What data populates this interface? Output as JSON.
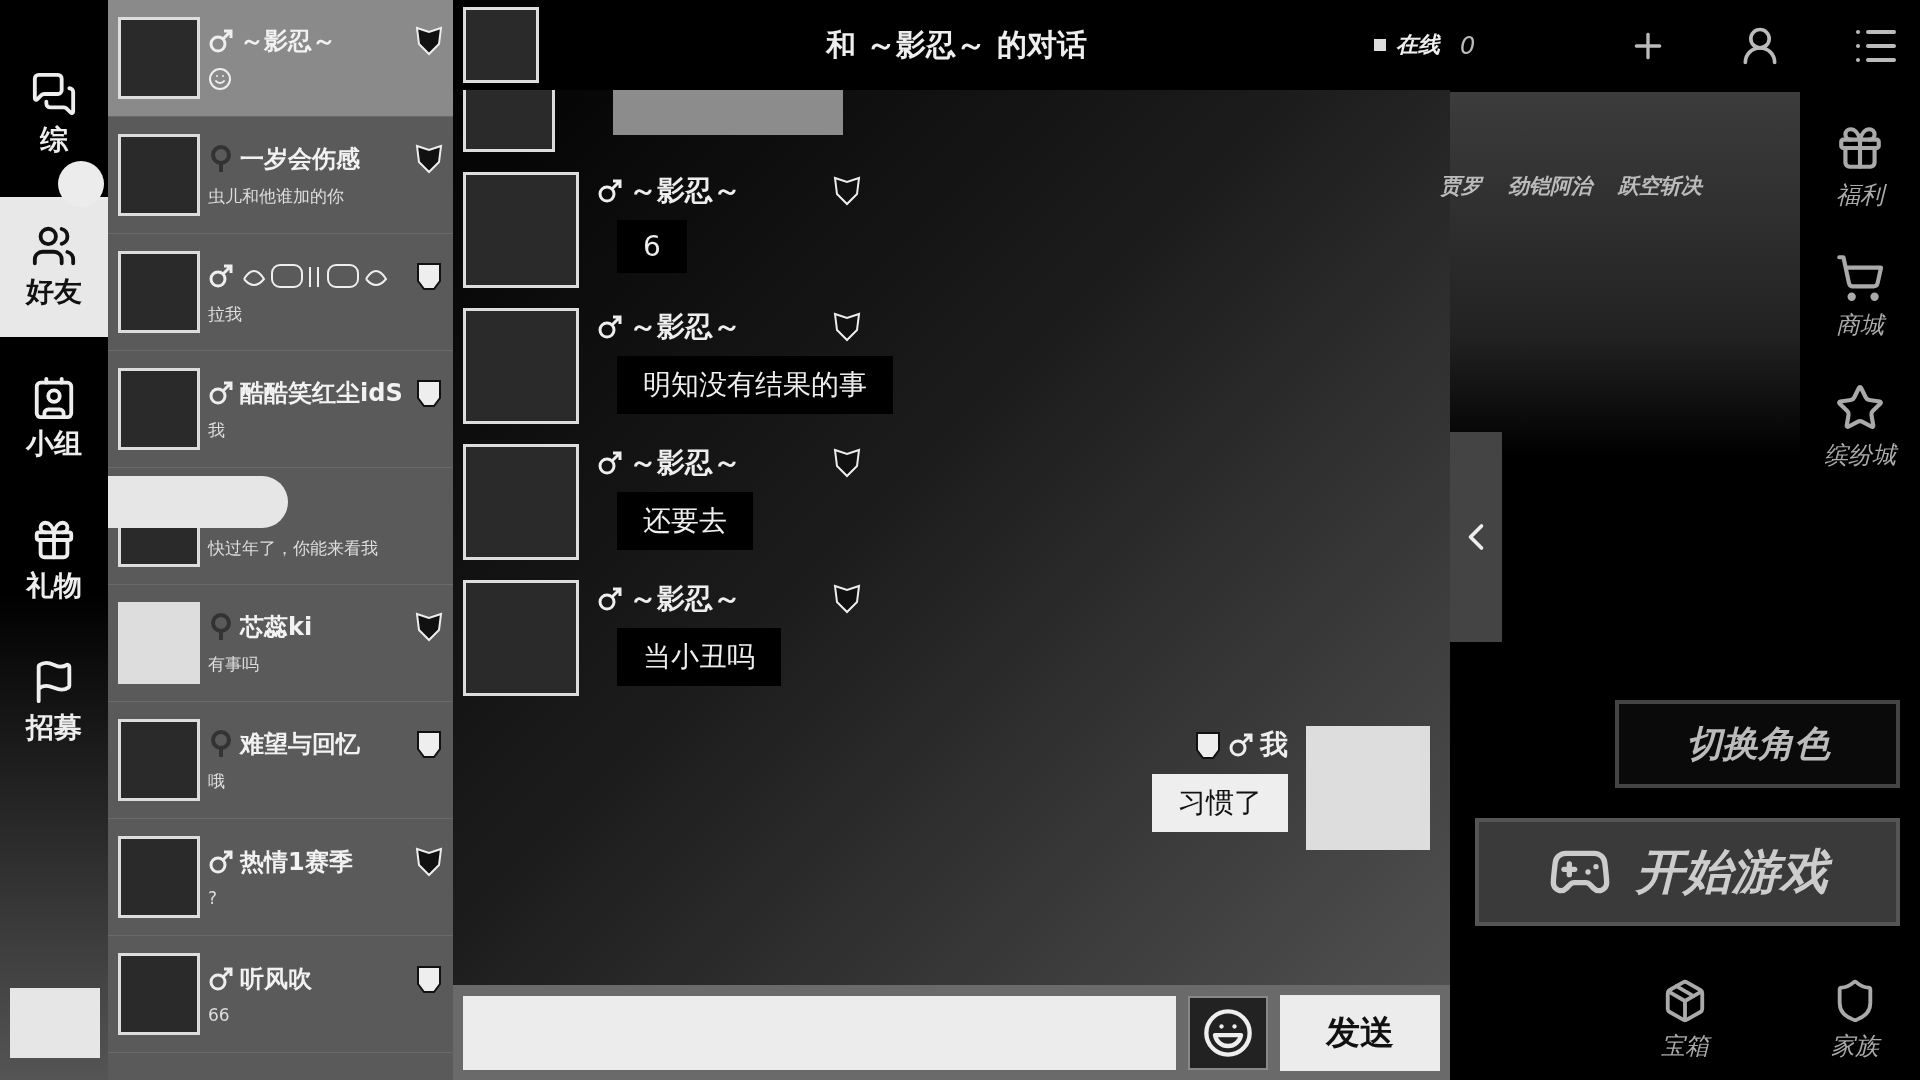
{
  "nav": [
    {
      "label": "综",
      "selected": false,
      "badge": true
    },
    {
      "label": "好友",
      "selected": true,
      "badge": false
    },
    {
      "label": "小组",
      "selected": false,
      "badge": false
    },
    {
      "label": "礼物",
      "selected": false,
      "badge": false
    },
    {
      "label": "招募",
      "selected": false,
      "badge": false
    }
  ],
  "friends": [
    {
      "name": "～影忍～",
      "male": true,
      "autobot": false,
      "emoji_message": true,
      "selected": true
    },
    {
      "name": "一岁会伤感",
      "male": false,
      "autobot": false,
      "message": "虫儿和他谁加的你",
      "selected": false
    },
    {
      "ornament_name": true,
      "male": true,
      "autobot": true,
      "message": "拉我",
      "selected": false
    },
    {
      "name": "酷酷笑红尘idS",
      "male": true,
      "autobot": true,
      "message": "我",
      "selected": false
    },
    {
      "redacted": true,
      "message": "快过年了，你能来看我",
      "selected": false
    },
    {
      "name": "芯蕊ki",
      "male": false,
      "autobot": false,
      "message": "有事吗",
      "selected": false
    },
    {
      "name": "难望与回忆",
      "male": false,
      "autobot": true,
      "message": "哦",
      "selected": false
    },
    {
      "name": "热情1赛季",
      "male": true,
      "autobot": false,
      "message": "?",
      "selected": false
    },
    {
      "name": "听风吹",
      "male": true,
      "autobot": true,
      "message": "66",
      "selected": false
    }
  ],
  "chat": {
    "title": "和 ～影忍～ 的对话",
    "status": "在线",
    "count": "0",
    "messages": [
      {
        "redacted": true
      },
      {
        "mine": false,
        "sender": "～影忍～",
        "autobot": false,
        "text": "6"
      },
      {
        "mine": false,
        "sender": "～影忍～",
        "autobot": false,
        "text": "明知没有结果的事"
      },
      {
        "mine": false,
        "sender": "～影忍～",
        "autobot": false,
        "text": "还要去"
      },
      {
        "mine": false,
        "sender": "～影忍～",
        "autobot": false,
        "text": "当小丑吗"
      },
      {
        "mine": true,
        "sender": "我",
        "autobot": true,
        "text": "习惯了"
      }
    ],
    "send": "发送"
  },
  "game": {
    "heroes": [
      "贾罗",
      "劲铠阿治",
      "跃空斩决"
    ],
    "side_menu": [
      {
        "label": "福利",
        "kind": "gift"
      },
      {
        "label": "商城",
        "kind": "cart"
      },
      {
        "label": "缤纷城",
        "kind": "star"
      }
    ],
    "switch_role": "切换角色",
    "start": "开始游戏",
    "bottom": [
      {
        "label": "宝箱",
        "kind": "chest"
      },
      {
        "label": "家族",
        "kind": "shield"
      }
    ]
  }
}
